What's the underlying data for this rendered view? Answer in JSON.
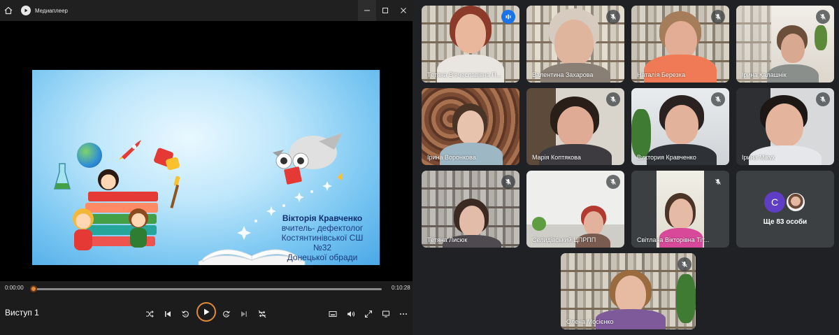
{
  "player": {
    "window_title": "Медиаплеер",
    "current_time": "0:00:00",
    "total_time": "0:10:28",
    "progress_fraction": 0.0,
    "track_title": "Виступ 1",
    "slide": {
      "name": "Вікторія Кравченко",
      "line2": "вчитель- дефектолог",
      "line3": "Костянтинівської СШ",
      "line4": "№32",
      "line5": "Донецької обради"
    }
  },
  "meet": {
    "participants": [
      {
        "name": "Тетяна В'ячеславівна П..."
      },
      {
        "name": "Валентина Захарова"
      },
      {
        "name": "Наталія Березка"
      },
      {
        "name": "Ірина Калашнік"
      },
      {
        "name": "Ірина Воронкова"
      },
      {
        "name": "Марія Коптякова"
      },
      {
        "name": "Виктория Кравченко"
      },
      {
        "name": "Ірина Мікух"
      },
      {
        "name": "Тетяна Лисюк"
      },
      {
        "name": "Селидівський ЦПРПП"
      },
      {
        "name": "Світлана Вікторівна Тіт..."
      },
      {
        "name": "Олена Мосієнко"
      }
    ],
    "more": {
      "avatar_letter": "C",
      "label": "Ще 83 особи"
    }
  },
  "colors": {
    "accent": "#e08a3c",
    "speaking": "#1a73e8",
    "active_border": "#8ab4f8"
  }
}
